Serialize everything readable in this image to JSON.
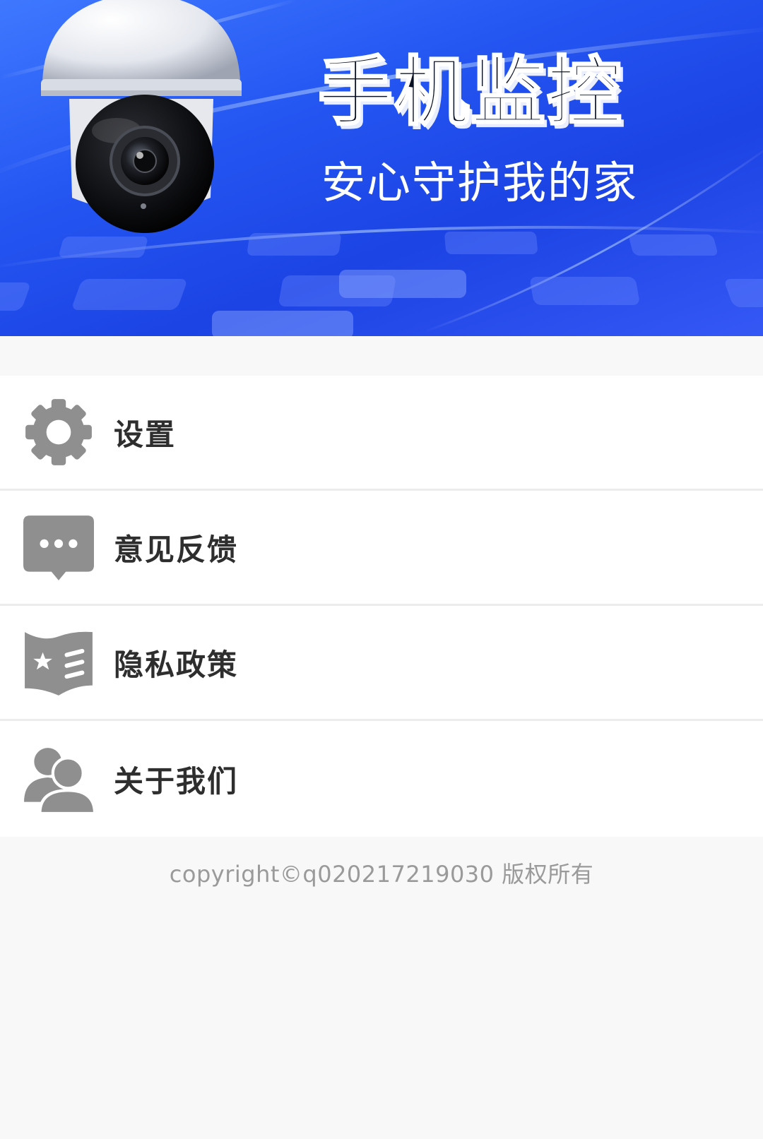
{
  "banner": {
    "title": "手机监控",
    "subtitle": "安心守护我的家",
    "image": "security-camera-banner"
  },
  "menu": {
    "items": [
      {
        "label": "设置",
        "icon": "gear-icon"
      },
      {
        "label": "意见反馈",
        "icon": "chat-bubble-icon"
      },
      {
        "label": "隐私政策",
        "icon": "book-star-icon"
      },
      {
        "label": "关于我们",
        "icon": "users-icon"
      }
    ]
  },
  "footer": {
    "copyright": "copyright©q020217219030 版权所有"
  },
  "colors": {
    "background": "#f8f8f8",
    "banner_blue": "#2456f2",
    "icon_gray": "#8f8f8f",
    "label_text": "#2e2e2e",
    "copyright_text": "#9a9a9a",
    "divider": "#ececec"
  }
}
